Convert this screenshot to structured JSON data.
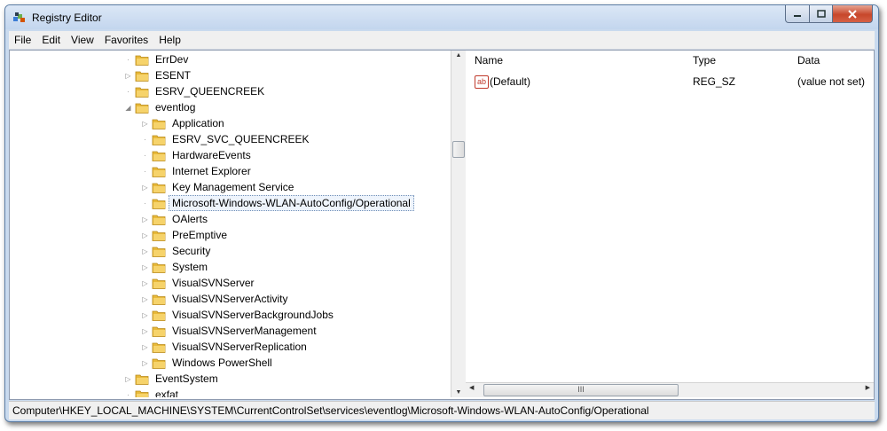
{
  "window": {
    "title": "Registry Editor"
  },
  "menu": [
    "File",
    "Edit",
    "View",
    "Favorites",
    "Help"
  ],
  "tree": {
    "nodes": [
      {
        "label": "ErrDev",
        "level": 2,
        "expander": ""
      },
      {
        "label": "ESENT",
        "level": 2,
        "expander": "▷"
      },
      {
        "label": "ESRV_QUEENCREEK",
        "level": 2,
        "expander": ""
      },
      {
        "label": "eventlog",
        "level": 2,
        "expander": "◢"
      },
      {
        "label": "Application",
        "level": 3,
        "expander": "▷"
      },
      {
        "label": "ESRV_SVC_QUEENCREEK",
        "level": 3,
        "expander": ""
      },
      {
        "label": "HardwareEvents",
        "level": 3,
        "expander": ""
      },
      {
        "label": "Internet Explorer",
        "level": 3,
        "expander": ""
      },
      {
        "label": "Key Management Service",
        "level": 3,
        "expander": "▷"
      },
      {
        "label": "Microsoft-Windows-WLAN-AutoConfig/Operational",
        "level": 3,
        "expander": "",
        "selected": true
      },
      {
        "label": "OAlerts",
        "level": 3,
        "expander": "▷"
      },
      {
        "label": "PreEmptive",
        "level": 3,
        "expander": "▷"
      },
      {
        "label": "Security",
        "level": 3,
        "expander": "▷"
      },
      {
        "label": "System",
        "level": 3,
        "expander": "▷"
      },
      {
        "label": "VisualSVNServer",
        "level": 3,
        "expander": "▷"
      },
      {
        "label": "VisualSVNServerActivity",
        "level": 3,
        "expander": "▷"
      },
      {
        "label": "VisualSVNServerBackgroundJobs",
        "level": 3,
        "expander": "▷"
      },
      {
        "label": "VisualSVNServerManagement",
        "level": 3,
        "expander": "▷"
      },
      {
        "label": "VisualSVNServerReplication",
        "level": 3,
        "expander": "▷"
      },
      {
        "label": "Windows PowerShell",
        "level": 3,
        "expander": "▷"
      },
      {
        "label": "EventSystem",
        "level": 2,
        "expander": "▷"
      },
      {
        "label": "exfat",
        "level": 2,
        "expander": ""
      }
    ]
  },
  "list": {
    "columns": {
      "name": "Name",
      "type": "Type",
      "data": "Data"
    },
    "rows": [
      {
        "icon": "ab",
        "name": "(Default)",
        "type": "REG_SZ",
        "data": "(value not set)"
      }
    ],
    "hscroll_grip": "III"
  },
  "status": {
    "path": "Computer\\HKEY_LOCAL_MACHINE\\SYSTEM\\CurrentControlSet\\services\\eventlog\\Microsoft-Windows-WLAN-AutoConfig/Operational"
  }
}
